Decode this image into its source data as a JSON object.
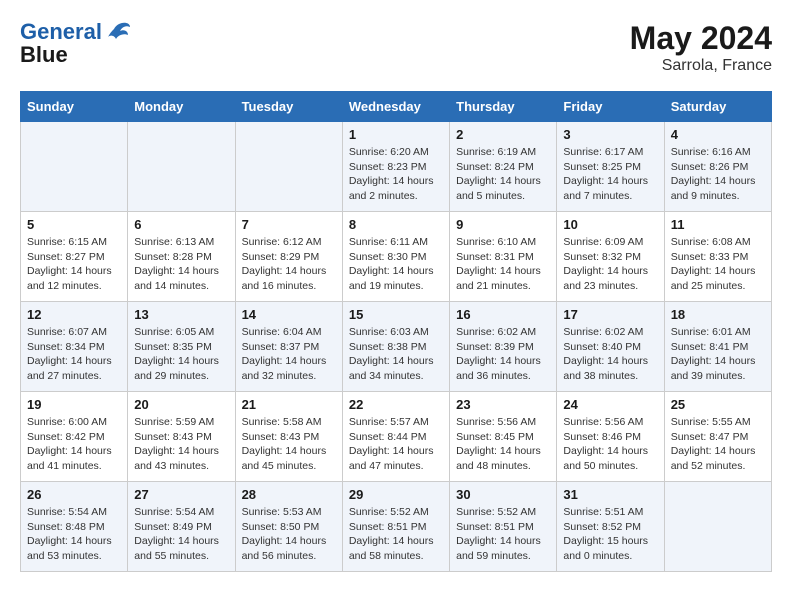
{
  "header": {
    "logo_line1": "General",
    "logo_line2": "Blue",
    "month_year": "May 2024",
    "location": "Sarrola, France"
  },
  "weekdays": [
    "Sunday",
    "Monday",
    "Tuesday",
    "Wednesday",
    "Thursday",
    "Friday",
    "Saturday"
  ],
  "weeks": [
    [
      {
        "day": "",
        "info": ""
      },
      {
        "day": "",
        "info": ""
      },
      {
        "day": "",
        "info": ""
      },
      {
        "day": "1",
        "info": "Sunrise: 6:20 AM\nSunset: 8:23 PM\nDaylight: 14 hours\nand 2 minutes."
      },
      {
        "day": "2",
        "info": "Sunrise: 6:19 AM\nSunset: 8:24 PM\nDaylight: 14 hours\nand 5 minutes."
      },
      {
        "day": "3",
        "info": "Sunrise: 6:17 AM\nSunset: 8:25 PM\nDaylight: 14 hours\nand 7 minutes."
      },
      {
        "day": "4",
        "info": "Sunrise: 6:16 AM\nSunset: 8:26 PM\nDaylight: 14 hours\nand 9 minutes."
      }
    ],
    [
      {
        "day": "5",
        "info": "Sunrise: 6:15 AM\nSunset: 8:27 PM\nDaylight: 14 hours\nand 12 minutes."
      },
      {
        "day": "6",
        "info": "Sunrise: 6:13 AM\nSunset: 8:28 PM\nDaylight: 14 hours\nand 14 minutes."
      },
      {
        "day": "7",
        "info": "Sunrise: 6:12 AM\nSunset: 8:29 PM\nDaylight: 14 hours\nand 16 minutes."
      },
      {
        "day": "8",
        "info": "Sunrise: 6:11 AM\nSunset: 8:30 PM\nDaylight: 14 hours\nand 19 minutes."
      },
      {
        "day": "9",
        "info": "Sunrise: 6:10 AM\nSunset: 8:31 PM\nDaylight: 14 hours\nand 21 minutes."
      },
      {
        "day": "10",
        "info": "Sunrise: 6:09 AM\nSunset: 8:32 PM\nDaylight: 14 hours\nand 23 minutes."
      },
      {
        "day": "11",
        "info": "Sunrise: 6:08 AM\nSunset: 8:33 PM\nDaylight: 14 hours\nand 25 minutes."
      }
    ],
    [
      {
        "day": "12",
        "info": "Sunrise: 6:07 AM\nSunset: 8:34 PM\nDaylight: 14 hours\nand 27 minutes."
      },
      {
        "day": "13",
        "info": "Sunrise: 6:05 AM\nSunset: 8:35 PM\nDaylight: 14 hours\nand 29 minutes."
      },
      {
        "day": "14",
        "info": "Sunrise: 6:04 AM\nSunset: 8:37 PM\nDaylight: 14 hours\nand 32 minutes."
      },
      {
        "day": "15",
        "info": "Sunrise: 6:03 AM\nSunset: 8:38 PM\nDaylight: 14 hours\nand 34 minutes."
      },
      {
        "day": "16",
        "info": "Sunrise: 6:02 AM\nSunset: 8:39 PM\nDaylight: 14 hours\nand 36 minutes."
      },
      {
        "day": "17",
        "info": "Sunrise: 6:02 AM\nSunset: 8:40 PM\nDaylight: 14 hours\nand 38 minutes."
      },
      {
        "day": "18",
        "info": "Sunrise: 6:01 AM\nSunset: 8:41 PM\nDaylight: 14 hours\nand 39 minutes."
      }
    ],
    [
      {
        "day": "19",
        "info": "Sunrise: 6:00 AM\nSunset: 8:42 PM\nDaylight: 14 hours\nand 41 minutes."
      },
      {
        "day": "20",
        "info": "Sunrise: 5:59 AM\nSunset: 8:43 PM\nDaylight: 14 hours\nand 43 minutes."
      },
      {
        "day": "21",
        "info": "Sunrise: 5:58 AM\nSunset: 8:43 PM\nDaylight: 14 hours\nand 45 minutes."
      },
      {
        "day": "22",
        "info": "Sunrise: 5:57 AM\nSunset: 8:44 PM\nDaylight: 14 hours\nand 47 minutes."
      },
      {
        "day": "23",
        "info": "Sunrise: 5:56 AM\nSunset: 8:45 PM\nDaylight: 14 hours\nand 48 minutes."
      },
      {
        "day": "24",
        "info": "Sunrise: 5:56 AM\nSunset: 8:46 PM\nDaylight: 14 hours\nand 50 minutes."
      },
      {
        "day": "25",
        "info": "Sunrise: 5:55 AM\nSunset: 8:47 PM\nDaylight: 14 hours\nand 52 minutes."
      }
    ],
    [
      {
        "day": "26",
        "info": "Sunrise: 5:54 AM\nSunset: 8:48 PM\nDaylight: 14 hours\nand 53 minutes."
      },
      {
        "day": "27",
        "info": "Sunrise: 5:54 AM\nSunset: 8:49 PM\nDaylight: 14 hours\nand 55 minutes."
      },
      {
        "day": "28",
        "info": "Sunrise: 5:53 AM\nSunset: 8:50 PM\nDaylight: 14 hours\nand 56 minutes."
      },
      {
        "day": "29",
        "info": "Sunrise: 5:52 AM\nSunset: 8:51 PM\nDaylight: 14 hours\nand 58 minutes."
      },
      {
        "day": "30",
        "info": "Sunrise: 5:52 AM\nSunset: 8:51 PM\nDaylight: 14 hours\nand 59 minutes."
      },
      {
        "day": "31",
        "info": "Sunrise: 5:51 AM\nSunset: 8:52 PM\nDaylight: 15 hours\nand 0 minutes."
      },
      {
        "day": "",
        "info": ""
      }
    ]
  ]
}
